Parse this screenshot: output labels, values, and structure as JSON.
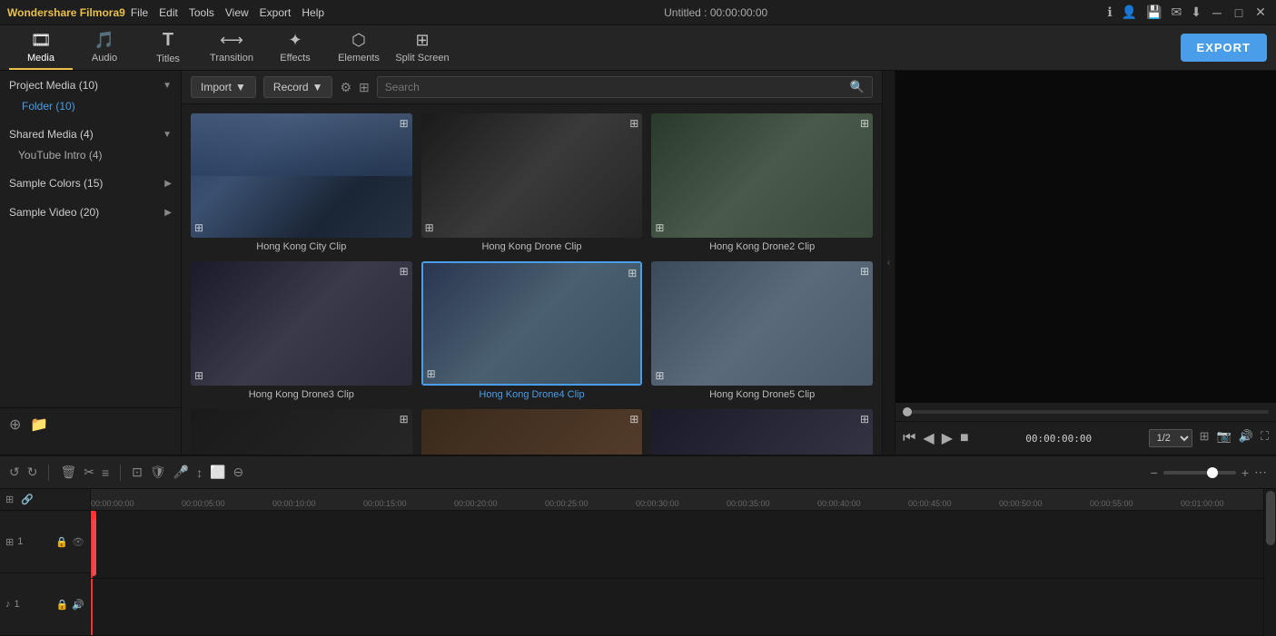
{
  "app": {
    "title": "Wondershare Filmora9",
    "project_title": "Untitled : 00:00:00:00"
  },
  "menu": {
    "items": [
      "File",
      "Edit",
      "Tools",
      "View",
      "Export",
      "Help"
    ]
  },
  "toolbar": {
    "items": [
      {
        "id": "media",
        "label": "Media",
        "icon": "🎞",
        "active": true
      },
      {
        "id": "audio",
        "label": "Audio",
        "icon": "🎵",
        "active": false
      },
      {
        "id": "titles",
        "label": "Titles",
        "icon": "T",
        "active": false
      },
      {
        "id": "transition",
        "label": "Transition",
        "icon": "⟷",
        "active": false
      },
      {
        "id": "effects",
        "label": "Effects",
        "icon": "✨",
        "active": false
      },
      {
        "id": "elements",
        "label": "Elements",
        "icon": "⬡",
        "active": false
      },
      {
        "id": "splitscreen",
        "label": "Split Screen",
        "icon": "⊞",
        "active": false
      }
    ],
    "export_label": "EXPORT"
  },
  "sidebar": {
    "sections": [
      {
        "id": "project-media",
        "label": "Project Media (10)",
        "expanded": true,
        "items": [
          {
            "id": "folder",
            "label": "Folder (10)",
            "type": "folder",
            "active": true
          }
        ]
      },
      {
        "id": "shared-media",
        "label": "Shared Media (4)",
        "expanded": true,
        "items": [
          {
            "id": "youtube-intro",
            "label": "YouTube Intro (4)",
            "type": "item",
            "active": false
          }
        ]
      },
      {
        "id": "sample-colors",
        "label": "Sample Colors (15)",
        "expanded": false,
        "items": []
      },
      {
        "id": "sample-video",
        "label": "Sample Video (20)",
        "expanded": false,
        "items": []
      }
    ]
  },
  "media_toolbar": {
    "import_label": "Import",
    "record_label": "Record",
    "search_placeholder": "Search"
  },
  "media_grid": {
    "items": [
      {
        "id": "hk-city",
        "label": "Hong Kong City Clip",
        "active": false,
        "thumb_class": "thumb-city"
      },
      {
        "id": "hk-drone",
        "label": "Hong Kong Drone Clip",
        "active": false,
        "thumb_class": "thumb-drone"
      },
      {
        "id": "hk-drone2",
        "label": "Hong Kong Drone2 Clip",
        "active": false,
        "thumb_class": "thumb-drone2"
      },
      {
        "id": "hk-drone3",
        "label": "Hong Kong Drone3 Clip",
        "active": false,
        "thumb_class": "thumb-drone3"
      },
      {
        "id": "hk-drone4",
        "label": "Hong Kong Drone4 Clip",
        "active": true,
        "thumb_class": "thumb-drone4"
      },
      {
        "id": "hk-drone5",
        "label": "Hong Kong Drone5 Clip",
        "active": false,
        "thumb_class": "thumb-drone5"
      },
      {
        "id": "hk-row3a",
        "label": "",
        "active": false,
        "thumb_class": "thumb-row3a"
      },
      {
        "id": "hk-row3b",
        "label": "",
        "active": false,
        "thumb_class": "thumb-row3b"
      },
      {
        "id": "hk-row3c",
        "label": "",
        "active": false,
        "thumb_class": "thumb-row3c"
      }
    ]
  },
  "preview": {
    "time_display": "00:00:00:00",
    "progress": 0
  },
  "timeline": {
    "toolbar": {
      "undo_label": "↺",
      "redo_label": "↻",
      "delete_label": "🗑",
      "cut_label": "✂",
      "adjust_label": "≡"
    },
    "ruler_marks": [
      "00:00:00:00",
      "00:00:05:00",
      "00:00:10:00",
      "00:00:15:00",
      "00:00:20:00",
      "00:00:25:00",
      "00:00:30:00",
      "00:00:35:00",
      "00:00:40:00",
      "00:00:45:00",
      "00:00:50:00",
      "00:00:55:00",
      "00:01:00:00"
    ],
    "tracks": [
      {
        "id": "video-1",
        "icon": "⊞",
        "label": "1",
        "type": "video"
      },
      {
        "id": "audio-1",
        "icon": "♪",
        "label": "1",
        "type": "audio"
      }
    ],
    "time_display": "00:00:00:00",
    "zoom_level": "1/2"
  }
}
